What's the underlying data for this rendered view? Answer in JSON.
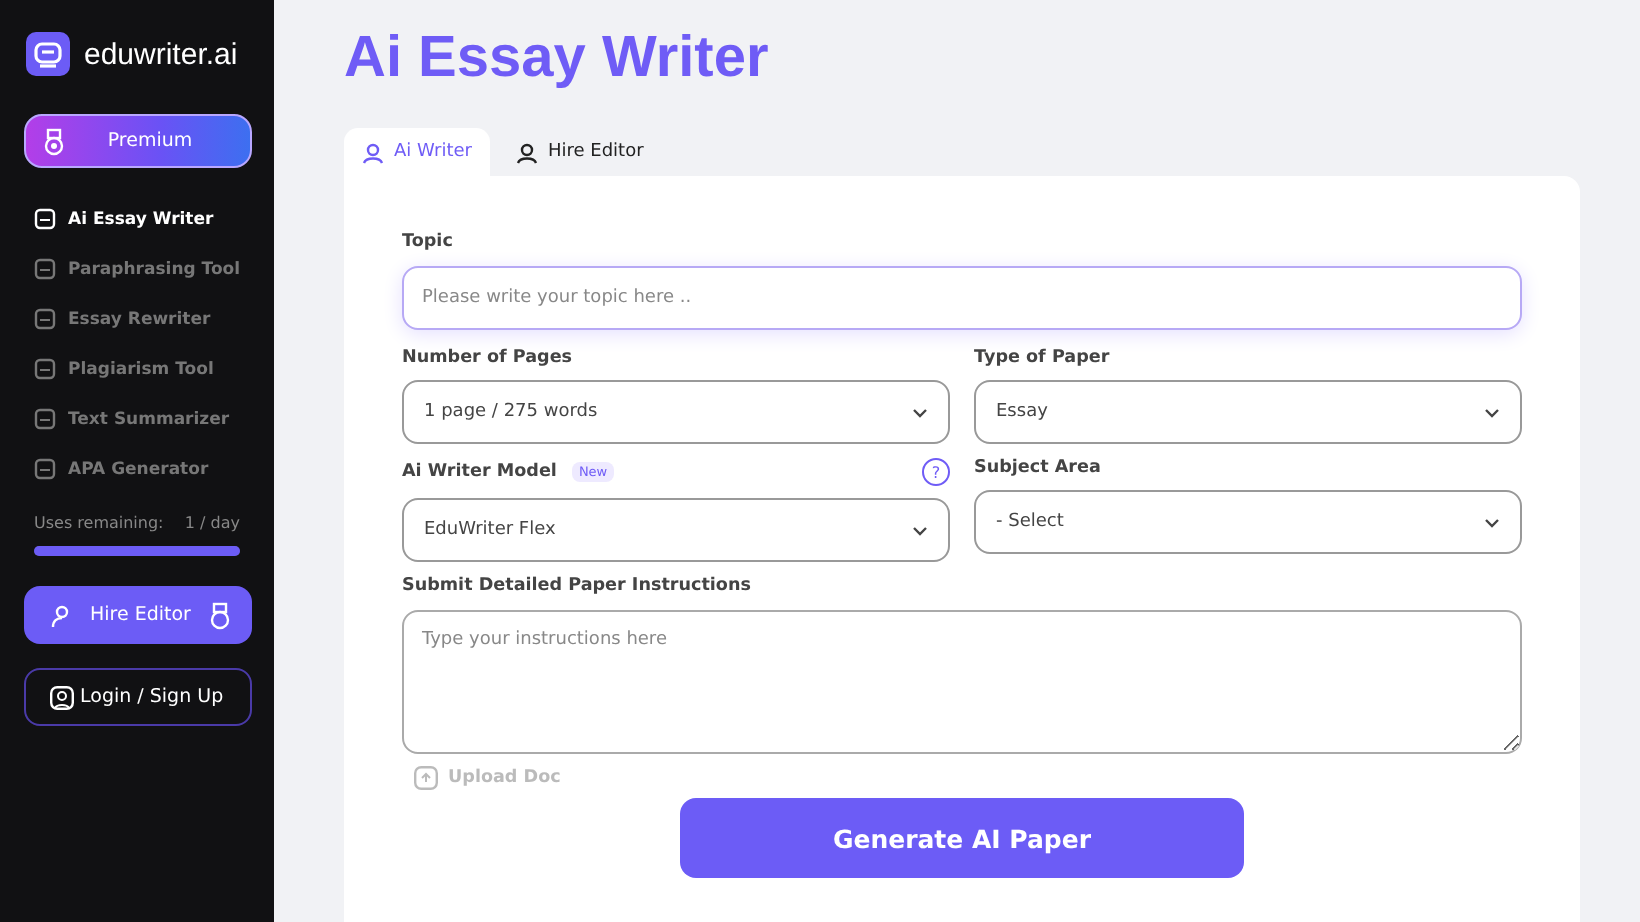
{
  "brand": {
    "name": "eduwriter.ai"
  },
  "premium_button": {
    "label": "Premium"
  },
  "sidebar": {
    "items": [
      {
        "label": "Ai Essay Writer",
        "selected": true
      },
      {
        "label": "Paraphrasing Tool",
        "selected": false
      },
      {
        "label": "Essay Rewriter",
        "selected": false
      },
      {
        "label": "Plagiarism Tool",
        "selected": false
      },
      {
        "label": "Text Summarizer",
        "selected": false
      },
      {
        "label": "APA Generator",
        "selected": false
      }
    ]
  },
  "usage": {
    "label": "Uses remaining:",
    "reading": "1 / day",
    "level": 1
  },
  "hire_button": {
    "label": "Hire Editor"
  },
  "login_button": {
    "label": "Login / Sign Up"
  },
  "page_title": "Ai Essay Writer",
  "tabs": [
    {
      "label": "Ai Writer",
      "selected": true
    },
    {
      "label": "Hire Editor",
      "selected": false
    }
  ],
  "form": {
    "topic": {
      "label": "Topic",
      "placeholder": "Please write your topic here .."
    },
    "pages": {
      "label": "Number of Pages",
      "value": "1 page / 275 words"
    },
    "paper_type": {
      "label": "Type of Paper",
      "value": "Essay"
    },
    "model": {
      "label": "Ai Writer Model",
      "badge": "New",
      "help": "?",
      "value": "EduWriter Flex"
    },
    "subject": {
      "label": "Subject Area",
      "value": "- Select"
    },
    "instructions": {
      "label": "Submit Detailed Paper Instructions",
      "placeholder": "Type your instructions here"
    },
    "upload": {
      "label": "Upload Doc"
    },
    "submit": {
      "label": "Generate AI Paper"
    }
  }
}
